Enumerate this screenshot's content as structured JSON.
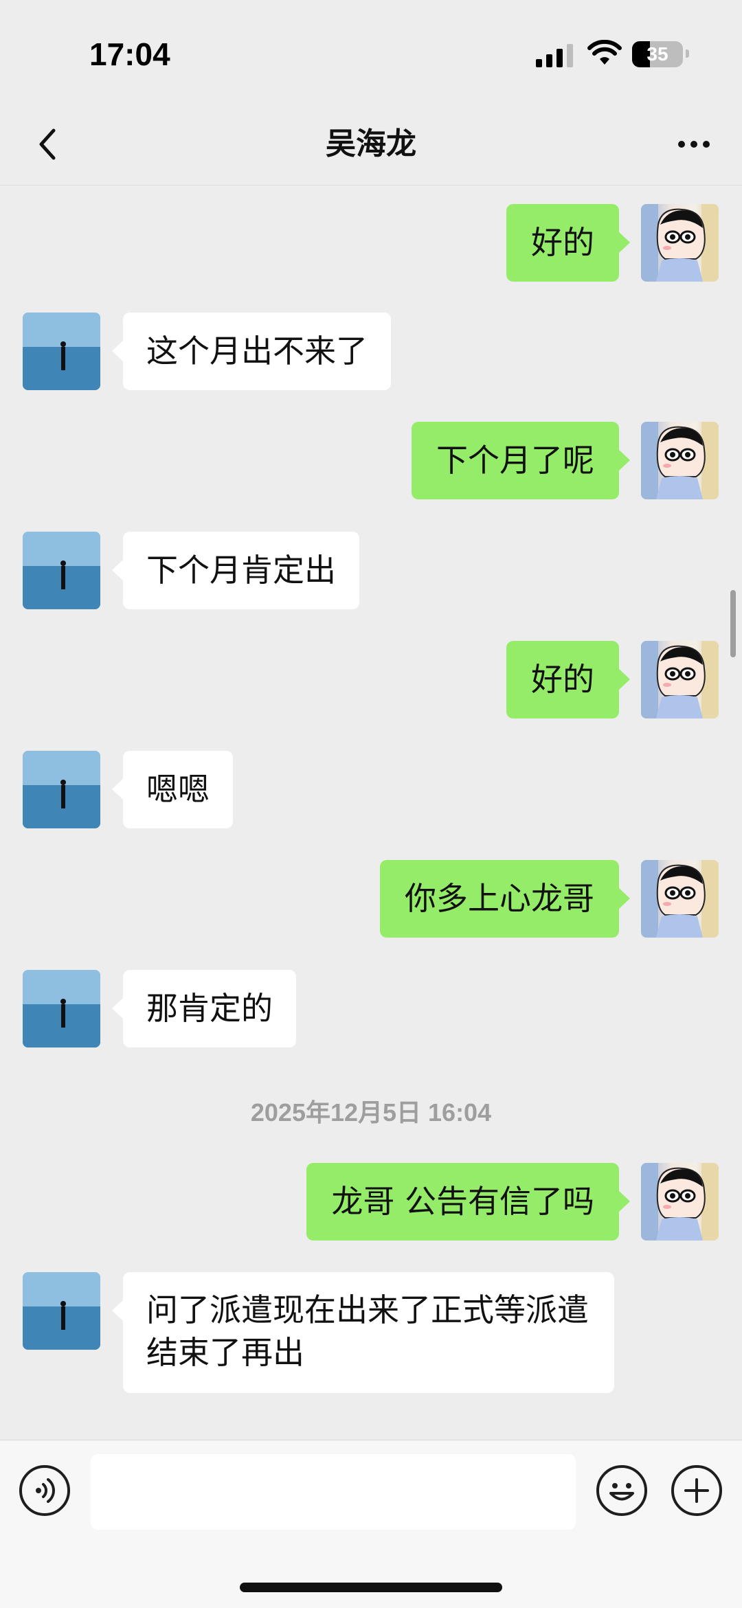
{
  "status_bar": {
    "time": "17:04",
    "battery": "35",
    "battery_level": 0.35,
    "icons": [
      "signal-icon",
      "wifi-icon",
      "battery-icon"
    ]
  },
  "nav": {
    "title": "吴海龙",
    "back_icon": "chevron-left-icon",
    "more_icon": "more-icon"
  },
  "messages": [
    {
      "side": "right",
      "text": "好的"
    },
    {
      "side": "left",
      "text": "这个月出不来了"
    },
    {
      "side": "right",
      "text": "下个月了呢"
    },
    {
      "side": "left",
      "text": "下个月肯定出"
    },
    {
      "side": "right",
      "text": "好的"
    },
    {
      "side": "left",
      "text": "嗯嗯"
    },
    {
      "side": "right",
      "text": "你多上心龙哥"
    },
    {
      "side": "left",
      "text": "那肯定的"
    },
    {
      "side": "right",
      "text": "龙哥 公告有信了吗"
    },
    {
      "side": "left",
      "text": "问了派遣现在出来了正式等派遣结束了再出"
    }
  ],
  "timestamp": "2025年12月5日 16:04",
  "input_bar": {
    "value": "",
    "icons": [
      "voice-icon",
      "emoji-icon",
      "plus-icon"
    ]
  },
  "colors": {
    "background": "#EDEDED",
    "bubble_self": "#95EC69",
    "bubble_other": "#FFFFFF",
    "timestamp": "#9E9E9E"
  }
}
